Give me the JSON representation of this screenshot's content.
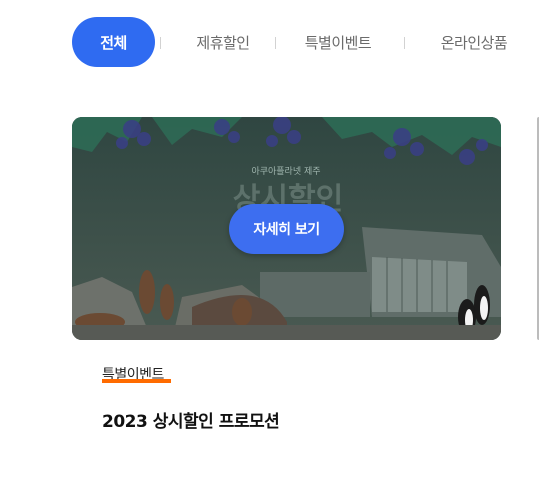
{
  "tabs": [
    {
      "label": "전체",
      "active": true
    },
    {
      "label": "제휴할인",
      "active": false
    },
    {
      "label": "특별이벤트",
      "active": false
    },
    {
      "label": "온라인상품",
      "active": false
    }
  ],
  "card": {
    "detail_button": "자세히 보기",
    "category": "특별이벤트",
    "title": "2023 상시할인 프로모션",
    "banner_small": "아쿠아플라넷 제주",
    "banner_big": "상시할인"
  },
  "colors": {
    "accent": "#2f6bf1",
    "category_underline": "#ff6b00"
  }
}
